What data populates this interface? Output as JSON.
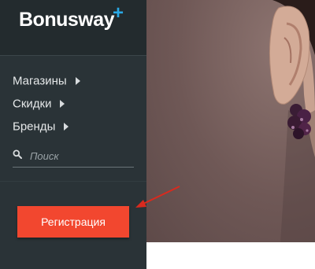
{
  "brand": {
    "logo_text": "Bonusway",
    "plus_symbol": "+",
    "accent_color": "#29a9e6"
  },
  "menu": {
    "items": [
      {
        "label": "Магазины",
        "icon": "chevron-right-icon"
      },
      {
        "label": "Скидки",
        "icon": "chevron-right-icon"
      },
      {
        "label": "Бренды",
        "icon": "chevron-right-icon"
      }
    ]
  },
  "search": {
    "placeholder": "Поиск",
    "value": "",
    "icon": "search-icon"
  },
  "register": {
    "label": "Регистрация",
    "color": "#f2472f"
  },
  "hero": {
    "description_icon": "hero-photo"
  },
  "annotation": {
    "icon": "red-arrow-icon",
    "color": "#d92a1e"
  }
}
